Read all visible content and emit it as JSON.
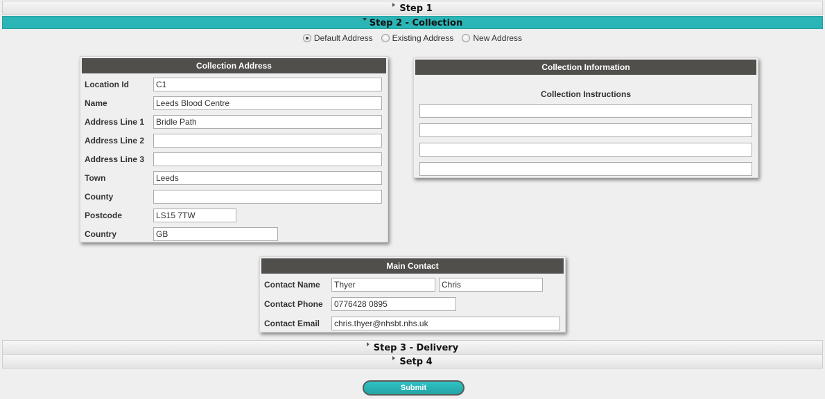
{
  "steps": {
    "step1": "Step 1",
    "step2": "Step 2 - Collection",
    "step3": "Step 3 - Delivery",
    "step4": "Setp 4"
  },
  "address_options": {
    "default": "Default Address",
    "existing": "Existing Address",
    "new": "New Address",
    "selected": "default"
  },
  "collection_address": {
    "title": "Collection Address",
    "location_id": {
      "label": "Location Id",
      "value": "C1"
    },
    "name": {
      "label": "Name",
      "value": "Leeds Blood Centre"
    },
    "address1": {
      "label": "Address Line 1",
      "value": "Bridle Path"
    },
    "address2": {
      "label": "Address Line 2",
      "value": ""
    },
    "address3": {
      "label": "Address Line 3",
      "value": ""
    },
    "town": {
      "label": "Town",
      "value": "Leeds"
    },
    "county": {
      "label": "County",
      "value": ""
    },
    "postcode": {
      "label": "Postcode",
      "value": "LS15 7TW"
    },
    "country": {
      "label": "Country",
      "value": "GB"
    }
  },
  "collection_information": {
    "title": "Collection Information",
    "instructions_label": "Collection Instructions",
    "lines": [
      "",
      "",
      "",
      ""
    ]
  },
  "main_contact": {
    "title": "Main Contact",
    "name_label": "Contact Name",
    "surname": "Thyer",
    "first_name": "Chris",
    "phone_label": "Contact Phone",
    "phone": "0776428 0895",
    "email_label": "Contact Email",
    "email": "chris.thyer@nhsbt.nhs.uk"
  },
  "submit_label": "Submit",
  "colors": {
    "accent": "#2bb5b6",
    "panel_header": "#514f4c",
    "background": "#efefef"
  }
}
